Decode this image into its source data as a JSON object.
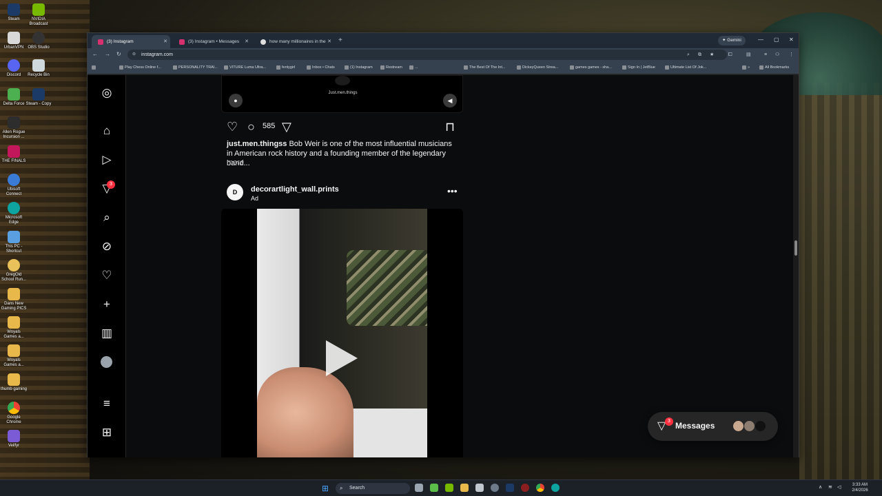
{
  "desktop": {
    "icons": [
      {
        "label": "Steam",
        "icon": "steam-icon"
      },
      {
        "label": "NVIDIA Broadcast",
        "icon": "nvidia-broadcast-icon"
      },
      {
        "label": "UrbanVPN",
        "icon": "urbanvpn-icon"
      },
      {
        "label": "OBS Studio",
        "icon": "obs-icon"
      },
      {
        "label": "Discord",
        "icon": "discord-icon"
      },
      {
        "label": "Recycle Bin",
        "icon": "recycle-bin-icon"
      },
      {
        "label": "Delta Force",
        "icon": "delta-force-icon"
      },
      {
        "label": "Steam - Copy",
        "icon": "steam-icon"
      },
      {
        "label": "Allen Rogue Incursion ...",
        "icon": "game-icon"
      },
      {
        "label": "THE FINALS",
        "icon": "game-icon"
      },
      {
        "label": "Ubisoft Connect",
        "icon": "ubisoft-icon"
      },
      {
        "label": "Microsoft Edge",
        "icon": "edge-icon"
      },
      {
        "label": "This PC - Shortcut",
        "icon": "pc-icon"
      },
      {
        "label": "GregOld School Run...",
        "icon": "game-icon"
      },
      {
        "label": "Dans New Gaming PICS",
        "icon": "folder-icon"
      },
      {
        "label": "Woyals Games a...",
        "icon": "folder-icon"
      },
      {
        "label": "Woyals Games a...",
        "icon": "folder-icon"
      },
      {
        "label": "thumb gaming",
        "icon": "folder-icon"
      },
      {
        "label": "Google Chrome",
        "icon": "chrome-icon"
      },
      {
        "label": "Veilfyr",
        "icon": "app-icon"
      }
    ]
  },
  "browser": {
    "tabs": [
      {
        "label": "(3) Instagram",
        "active": true
      },
      {
        "label": "(3) Instagram • Messages",
        "active": false
      },
      {
        "label": "how many millionaires in the u",
        "active": false
      }
    ],
    "gemini_label": "Gemini",
    "url": "instagram.com",
    "bookmarks": [
      "Play Chess Online f...",
      "PERSONALITY TRAI...",
      "VITURE Luma Ultra...",
      "fentygirl",
      "Inbox • Chats",
      "(1) Instagram",
      "Restream",
      "...",
      "The Best Of The Int...",
      "DickeyQueen Strea...",
      "games games - sha...",
      "Sign In | JetBlue",
      "Ultimate List Of Jok..."
    ],
    "all_bookmarks": "All Bookmarks"
  },
  "instagram": {
    "nav_badge": "3",
    "top_video": {
      "watermark": "Just.men.things"
    },
    "post1": {
      "comment_count": "585",
      "username": "just.men.thingss",
      "caption": "Bob Weir is one of the most influential musicians in American rock history and a founding member of the legendary band...",
      "more": "more"
    },
    "post2": {
      "avatar_letter": "D",
      "username": "decorartlight_wall.prints",
      "sponsored": "Ad"
    },
    "messages": {
      "label": "Messages",
      "badge": "3"
    }
  },
  "taskbar": {
    "search_label": "Search",
    "time": "3:33 AM",
    "date": "2/4/2026"
  },
  "colors": {
    "instagram_bg": "#000000",
    "badge_red": "#ff3040",
    "browser_chrome": "#35414e"
  }
}
